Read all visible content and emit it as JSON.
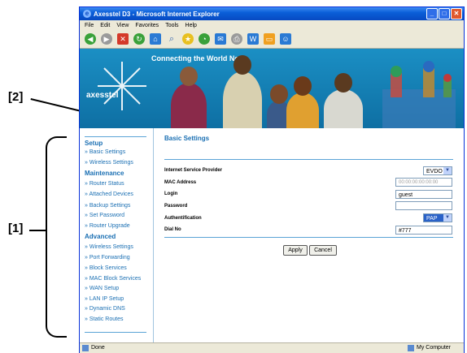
{
  "callouts": {
    "label1": "[1]",
    "label2": "[2]"
  },
  "window": {
    "title": "Axesstel D3 - Microsoft Internet Explorer",
    "menu": [
      "File",
      "Edit",
      "View",
      "Favorites",
      "Tools",
      "Help"
    ],
    "controls": {
      "minimize": "_",
      "maximize": "□",
      "close": "✕"
    }
  },
  "banner": {
    "tagline": "Connecting the World Now",
    "logo": "axesstel"
  },
  "sidebar": {
    "setup": {
      "heading": "Setup",
      "items": [
        "Basic Settings",
        "Wireless Settings"
      ]
    },
    "maintenance": {
      "heading": "Maintenance",
      "items": [
        "Router Status",
        "Attached Devices",
        "Backup Settings",
        "Set Password",
        "Router Upgrade"
      ]
    },
    "advanced": {
      "heading": "Advanced",
      "items": [
        "Wireless Settings",
        "Port Forwarding",
        "Block Services",
        "MAC Block Services",
        "WAN Setup",
        "LAN IP Setup",
        "Dynamic DNS",
        "Static Routes"
      ]
    }
  },
  "main": {
    "title": "Basic Settings",
    "isp_label": "Internet Service Provider",
    "isp_value": "EVDO",
    "mac_label": "MAC Address",
    "mac_value": "00:00:00:00:00:00",
    "login_label": "Login",
    "login_value": "guest",
    "password_label": "Password",
    "password_value": "",
    "auth_label": "Authentification",
    "auth_value": "PAP",
    "dial_label": "Dial No",
    "dial_value": "#777",
    "apply": "Apply",
    "cancel": "Cancel"
  },
  "status": {
    "left": "Done",
    "right": "My Computer"
  }
}
